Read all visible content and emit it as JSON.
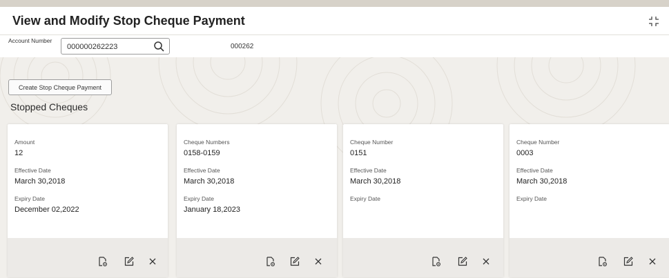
{
  "page": {
    "title": "View and Modify Stop Cheque Payment"
  },
  "account": {
    "label": "Account Number",
    "value": "000000262223",
    "code": "000262"
  },
  "actions": {
    "create_label": "Create Stop Cheque Payment"
  },
  "section": {
    "title": "Stopped Cheques"
  },
  "cards": [
    {
      "field1_label": "Amount",
      "field1_value": "12",
      "effective_label": "Effective Date",
      "effective_value": "March 30,2018",
      "expiry_label": "Expiry Date",
      "expiry_value": "December 02,2022"
    },
    {
      "field1_label": "Cheque Numbers",
      "field1_value": "0158-0159",
      "effective_label": "Effective Date",
      "effective_value": "March 30,2018",
      "expiry_label": "Expiry Date",
      "expiry_value": "January 18,2023"
    },
    {
      "field1_label": "Cheque Number",
      "field1_value": "0151",
      "effective_label": "Effective Date",
      "effective_value": "March 30,2018",
      "expiry_label": "Expiry Date",
      "expiry_value": ""
    },
    {
      "field1_label": "Cheque Number",
      "field1_value": "0003",
      "effective_label": "Effective Date",
      "effective_value": "March 30,2018",
      "expiry_label": "Expiry Date",
      "expiry_value": ""
    }
  ],
  "icons": {
    "view": "view-document-icon",
    "edit": "edit-icon",
    "delete": "close-icon",
    "search": "search-icon",
    "expand": "expand-icon"
  }
}
